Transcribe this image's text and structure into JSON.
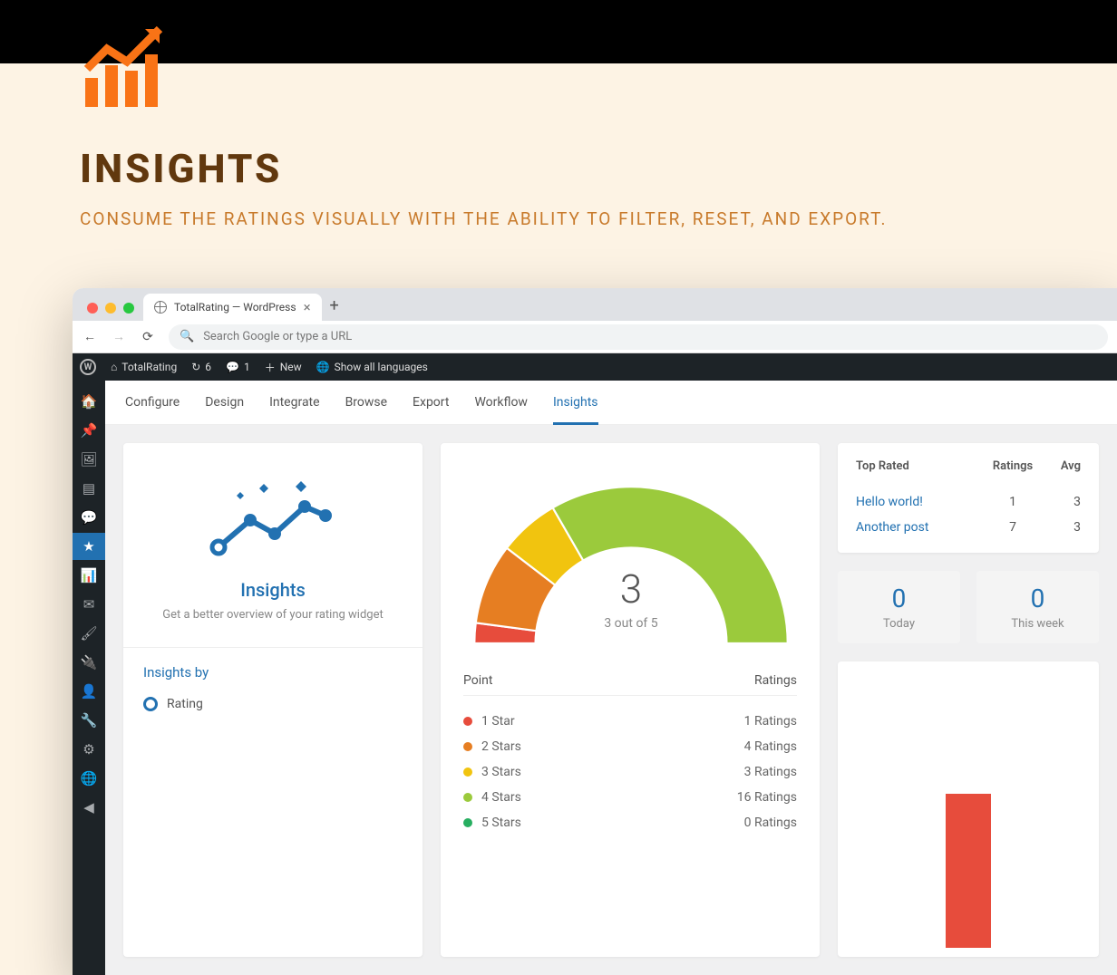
{
  "promo": {
    "title": "INSIGHTS",
    "subtitle": "CONSUME THE RATINGS VISUALLY WITH THE ABILITY TO FILTER, RESET, AND EXPORT."
  },
  "browser": {
    "tab_title": "TotalRating — WordPress",
    "placeholder": "Search Google or type a URL"
  },
  "wpbar": {
    "site": "TotalRating",
    "updates": "6",
    "comments": "1",
    "new": "New",
    "languages": "Show all languages"
  },
  "tabs": [
    "Configure",
    "Design",
    "Integrate",
    "Browse",
    "Export",
    "Workflow",
    "Insights"
  ],
  "active_tab_index": 6,
  "insights_card": {
    "title": "Insights",
    "subtitle": "Get a better overview of your rating widget",
    "by_label": "Insights by",
    "by_option": "Rating"
  },
  "gauge": {
    "value_text": "3",
    "subtext": "3 out of 5",
    "point_label": "Point",
    "ratings_label": "Ratings"
  },
  "star_colors": [
    "#e74c3c",
    "#e67e22",
    "#f1c40f",
    "#9bca3c",
    "#27ae60"
  ],
  "stars": [
    {
      "label": "1 Star",
      "ratings": "1 Ratings"
    },
    {
      "label": "2 Stars",
      "ratings": "4 Ratings"
    },
    {
      "label": "3 Stars",
      "ratings": "3 Ratings"
    },
    {
      "label": "4 Stars",
      "ratings": "16 Ratings"
    },
    {
      "label": "5 Stars",
      "ratings": "0 Ratings"
    }
  ],
  "top_rated": {
    "headers": {
      "name": "Top Rated",
      "ratings": "Ratings",
      "avg": "Avg"
    },
    "rows": [
      {
        "name": "Hello world!",
        "ratings": "1",
        "avg": "3"
      },
      {
        "name": "Another post",
        "ratings": "7",
        "avg": "3"
      }
    ]
  },
  "stats": [
    {
      "value": "0",
      "label": "Today"
    },
    {
      "value": "0",
      "label": "This week"
    }
  ],
  "chart_data": {
    "type": "bar",
    "title": "Rating distribution gauge",
    "categories": [
      "1 Star",
      "2 Stars",
      "3 Stars",
      "4 Stars",
      "5 Stars"
    ],
    "values": [
      1,
      4,
      3,
      16,
      0
    ],
    "average": 3,
    "max": 5,
    "average_text": "3 out of 5"
  }
}
